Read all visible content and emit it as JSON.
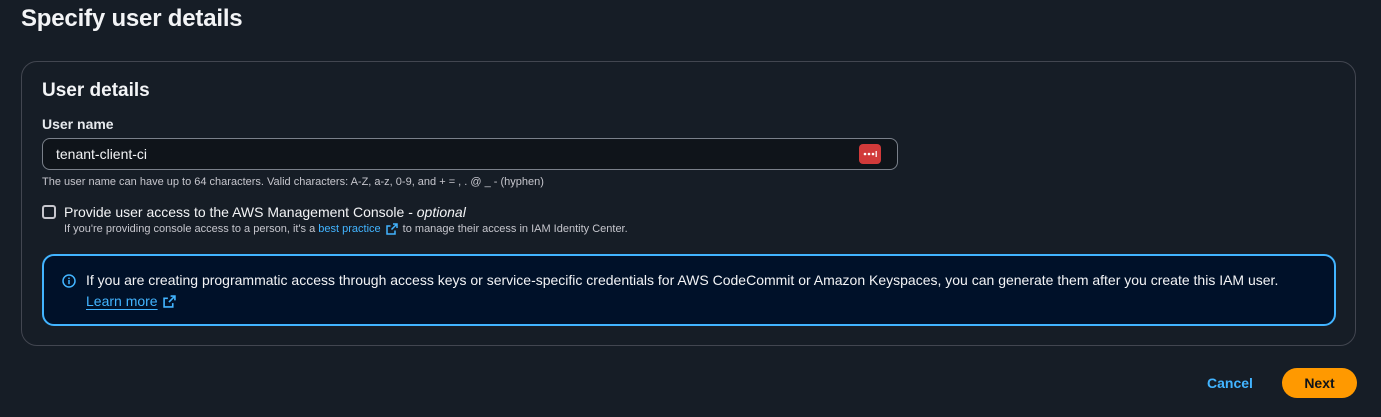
{
  "page": {
    "title": "Specify user details"
  },
  "panel": {
    "title": "User details",
    "username": {
      "label": "User name",
      "value": "tenant-client-ci",
      "constraint": "The user name can have up to 64 characters. Valid characters: A-Z, a-z, 0-9, and + = , . @ _ - (hyphen)",
      "password_manager_icon": "password-manager-icon"
    },
    "console_access": {
      "label": "Provide user access to the AWS Management Console - ",
      "optional": "optional",
      "checked": false,
      "desc_prefix": "If you're providing console access to a person, it's a",
      "desc_link": "best practice",
      "desc_suffix": "to manage their access in IAM Identity Center."
    },
    "info": {
      "icon": "info-icon",
      "text": "If you are creating programmatic access through access keys or service-specific credentials for AWS CodeCommit or Amazon Keyspaces, you can generate them after you create this IAM user.",
      "link": "Learn more"
    }
  },
  "actions": {
    "cancel": "Cancel",
    "next": "Next"
  },
  "colors": {
    "background": "#161d26",
    "link": "#42b4ff",
    "primary_button": "#ff9900",
    "info_background": "#001129"
  }
}
